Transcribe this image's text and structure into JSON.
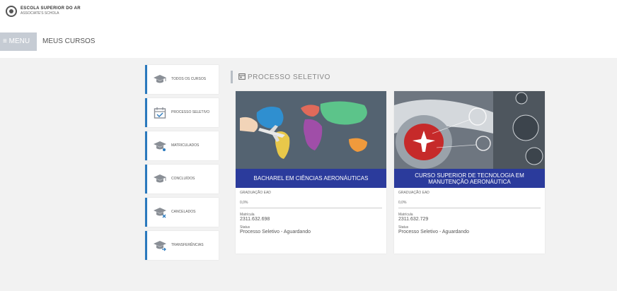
{
  "header": {
    "logo_line1": "ESCOLA SUPERIOR DO AR",
    "logo_line2": "ASSOCIATE'S SCHOLA"
  },
  "nav": {
    "menu_label": "≡ MENU",
    "my_courses_label": "MEUS CURSOS"
  },
  "sidebar": {
    "items": [
      {
        "label": "TODOS OS CURSOS",
        "icon": "graduation-cap-icon"
      },
      {
        "label": "PROCESSO SELETIVO",
        "icon": "calendar-icon"
      },
      {
        "label": "MATRICULADOS",
        "icon": "graduation-cap-icon"
      },
      {
        "label": "CONCLUÍDOS",
        "icon": "graduation-cap-icon"
      },
      {
        "label": "CANCELADOS",
        "icon": "graduation-cap-icon"
      },
      {
        "label": "TRANSFERÊNCIAS",
        "icon": "graduation-cap-icon"
      }
    ]
  },
  "section": {
    "title": "PROCESSO SELETIVO"
  },
  "cards": [
    {
      "banner": "BACHAREL EM CIÊNCIAS AERONÁUTICAS",
      "type": "GRADUAÇÃO EAD",
      "progress_text": "0,0%",
      "progress": 0,
      "matricula_label": "Matrícula",
      "matricula_value": "2311.632.698",
      "status_label": "Status",
      "status_value": "Processo Seletivo - Aguardando"
    },
    {
      "banner": "CURSO SUPERIOR DE TECNOLOGIA EM MANUTENÇÃO AERONÁUTICA",
      "type": "GRADUAÇÃO EAD",
      "progress_text": "0,0%",
      "progress": 0,
      "matricula_label": "Matrícula",
      "matricula_value": "2311.632.729",
      "status_label": "Status",
      "status_value": "Processo Seletivo - Aguardando"
    }
  ]
}
